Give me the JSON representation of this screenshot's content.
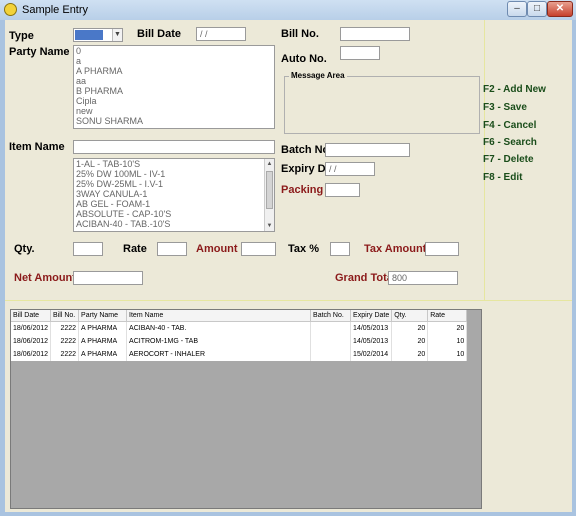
{
  "window": {
    "title": "Sample Entry",
    "minimize": "–",
    "maximize": "□",
    "close": "✕"
  },
  "form": {
    "type_label": "Type",
    "type_value": "",
    "bill_date_label": "Bill Date",
    "bill_date_value": "/ /",
    "bill_no_label": "Bill No.",
    "bill_no_value": "",
    "party_name_label": "Party Name",
    "party_names": [
      "0",
      "a",
      "A PHARMA",
      "aa",
      "B PHARMA",
      "Cipla",
      "new",
      "SONU SHARMA"
    ],
    "auto_no_label": "Auto No.",
    "auto_no_value": "",
    "message_area_label": "Message Area",
    "item_name_label": "Item Name",
    "item_name_value": "",
    "items": [
      "1-AL - TAB-10'S",
      "25% DW 100ML - IV-1",
      "25% DW-25ML - I.V-1",
      "3WAY CANULA-1",
      "AB GEL - FOAM-1",
      "ABSOLUTE - CAP-10'S",
      "ACIBAN-40 - TAB.-10'S"
    ],
    "batch_no_label": "Batch No.",
    "batch_no_value": "",
    "expiry_label": "Expiry Dt.",
    "expiry_value": "/ /",
    "packing_label": "Packing",
    "packing_value": "",
    "qty_label": "Qty.",
    "rate_label": "Rate",
    "amount_label": "Amount",
    "tax_pct_label": "Tax %",
    "tax_amount_label": "Tax Amount",
    "net_amount_label": "Net Amount",
    "grand_total_label": "Grand Total",
    "grand_total_value": "800"
  },
  "shortcuts": [
    "F2 - Add New",
    "F3 - Save",
    "F4 - Cancel",
    "F6 - Search",
    "F7 - Delete",
    "F8 - Edit"
  ],
  "grid": {
    "columns": [
      "Bill Date",
      "Bill No.",
      "Party Name",
      "Item Name",
      "Batch No.",
      "Expiry Date",
      "Qty.",
      "Rate"
    ],
    "rows": [
      [
        "18/06/2012",
        "2222",
        "A PHARMA",
        "ACIBAN-40 - TAB.",
        "",
        "14/05/2013",
        "20",
        "20"
      ],
      [
        "18/06/2012",
        "2222",
        "A PHARMA",
        "ACITROM-1MG - TAB",
        "",
        "14/05/2013",
        "20",
        "10"
      ],
      [
        "18/06/2012",
        "2222",
        "A PHARMA",
        "AEROCORT - INHALER",
        "",
        "15/02/2014",
        "20",
        "10"
      ]
    ]
  },
  "colors": {
    "accent_label": "#8b1a1a",
    "shortcut": "#1a4d1a",
    "selection": "#4a78c8"
  }
}
